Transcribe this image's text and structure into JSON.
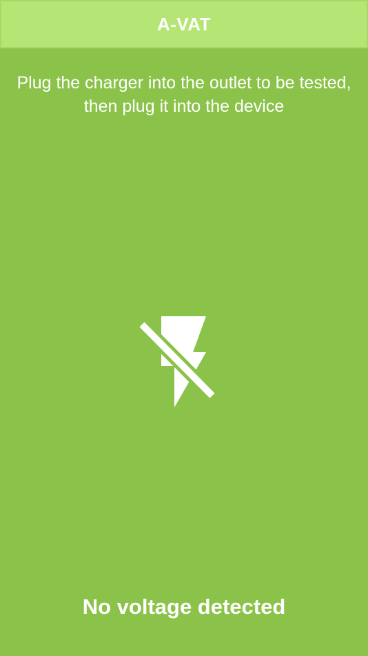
{
  "app_bar": {
    "title": "A-VAT"
  },
  "main": {
    "instruction": "Plug the charger into the outlet to be tested, then plug it into the device",
    "status_icon": "flash-off-icon",
    "status": "No voltage detected"
  },
  "colors": {
    "background": "#8bc34a",
    "app_bar": "#b5e675",
    "text": "#ffffff"
  }
}
